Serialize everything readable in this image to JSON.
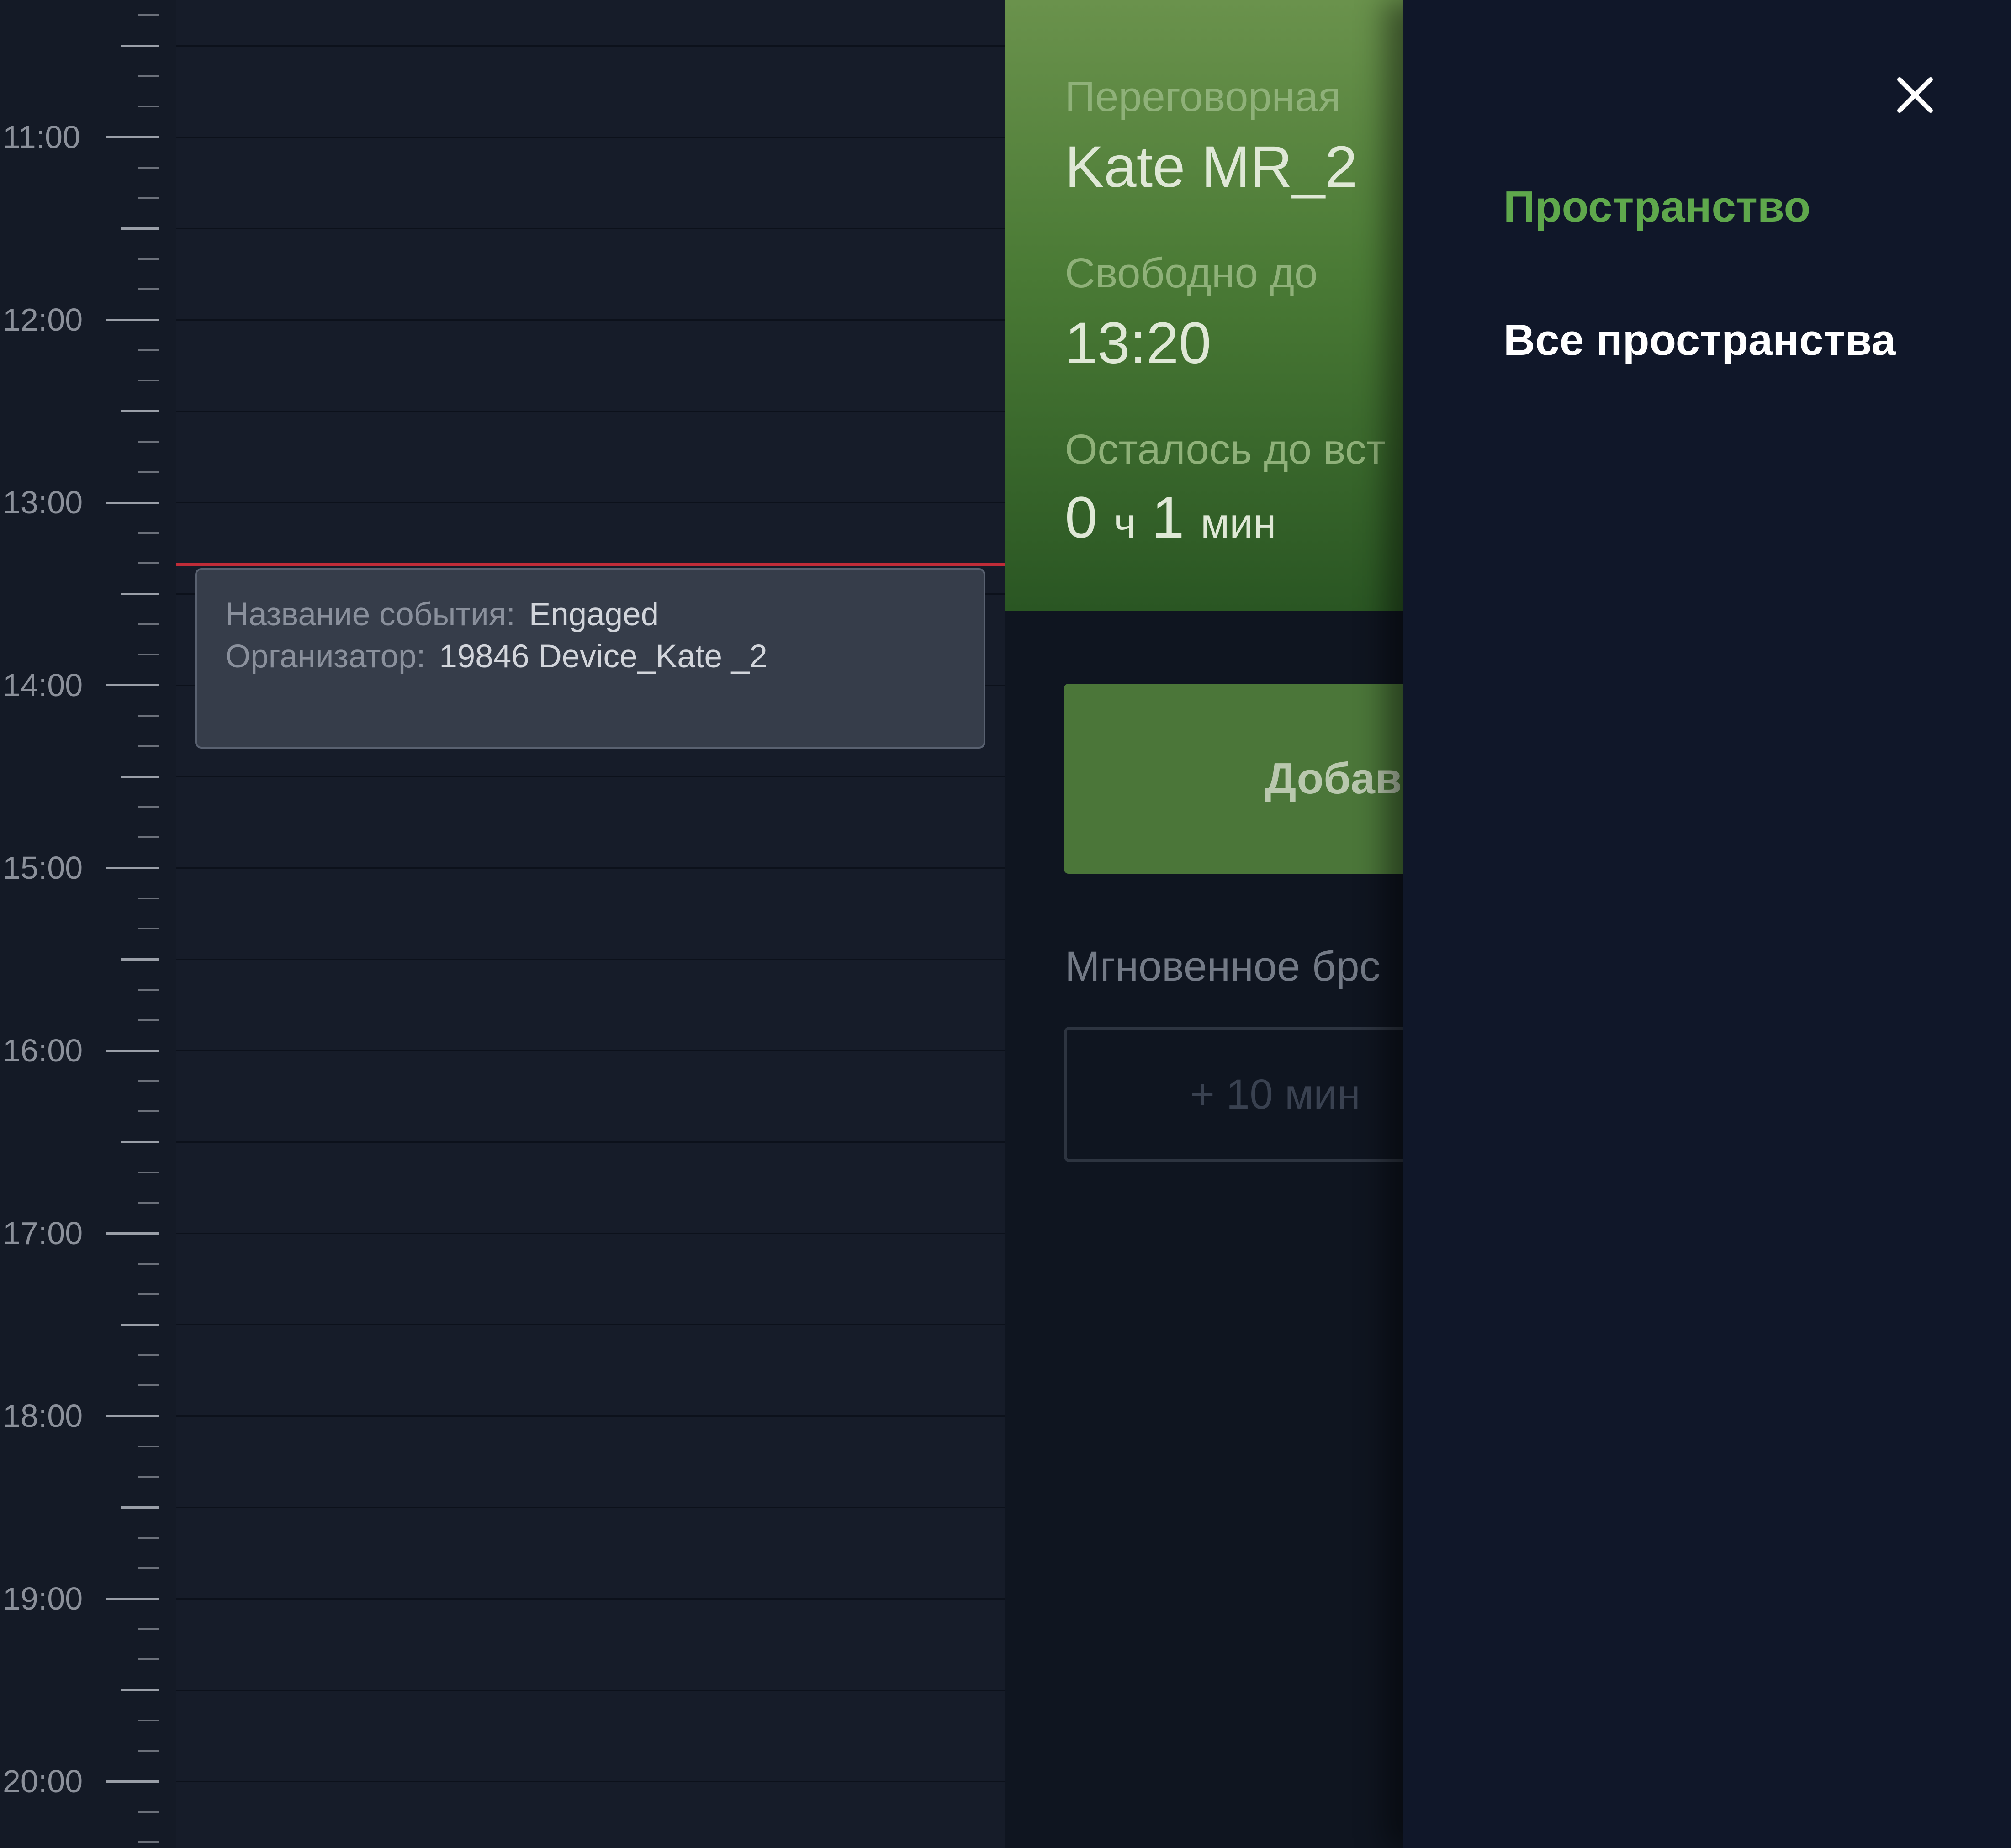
{
  "timeline": {
    "hours": [
      "11:00",
      "12:00",
      "13:00",
      "14:00",
      "15:00",
      "16:00",
      "17:00",
      "18:00",
      "19:00",
      "20:00"
    ]
  },
  "event": {
    "name_label": "Название события:",
    "name_value": "Engaged",
    "organizer_label": "Организатор:",
    "organizer_value": "19846 Device_Kate _2"
  },
  "room": {
    "type_label": "Переговорная",
    "name": "Kate MR_2",
    "free_until_label": "Свободно до",
    "free_until_value": "13:20",
    "remaining_label": "Осталось до вст",
    "remaining_hours": "0",
    "hours_unit": "ч",
    "remaining_minutes": "1",
    "minutes_unit": "мин",
    "add_button_label": "Добави",
    "instant_booking_label": "Мгновенное брс",
    "plus_10_label": "+ 10 мин"
  },
  "drawer": {
    "title": "Пространство",
    "all_spaces": "Все пространства",
    "close_icon": "close-icon"
  },
  "colors": {
    "accent_green": "#5fa84c",
    "now_line": "#c02c38",
    "status_free": "#4a7a35"
  }
}
